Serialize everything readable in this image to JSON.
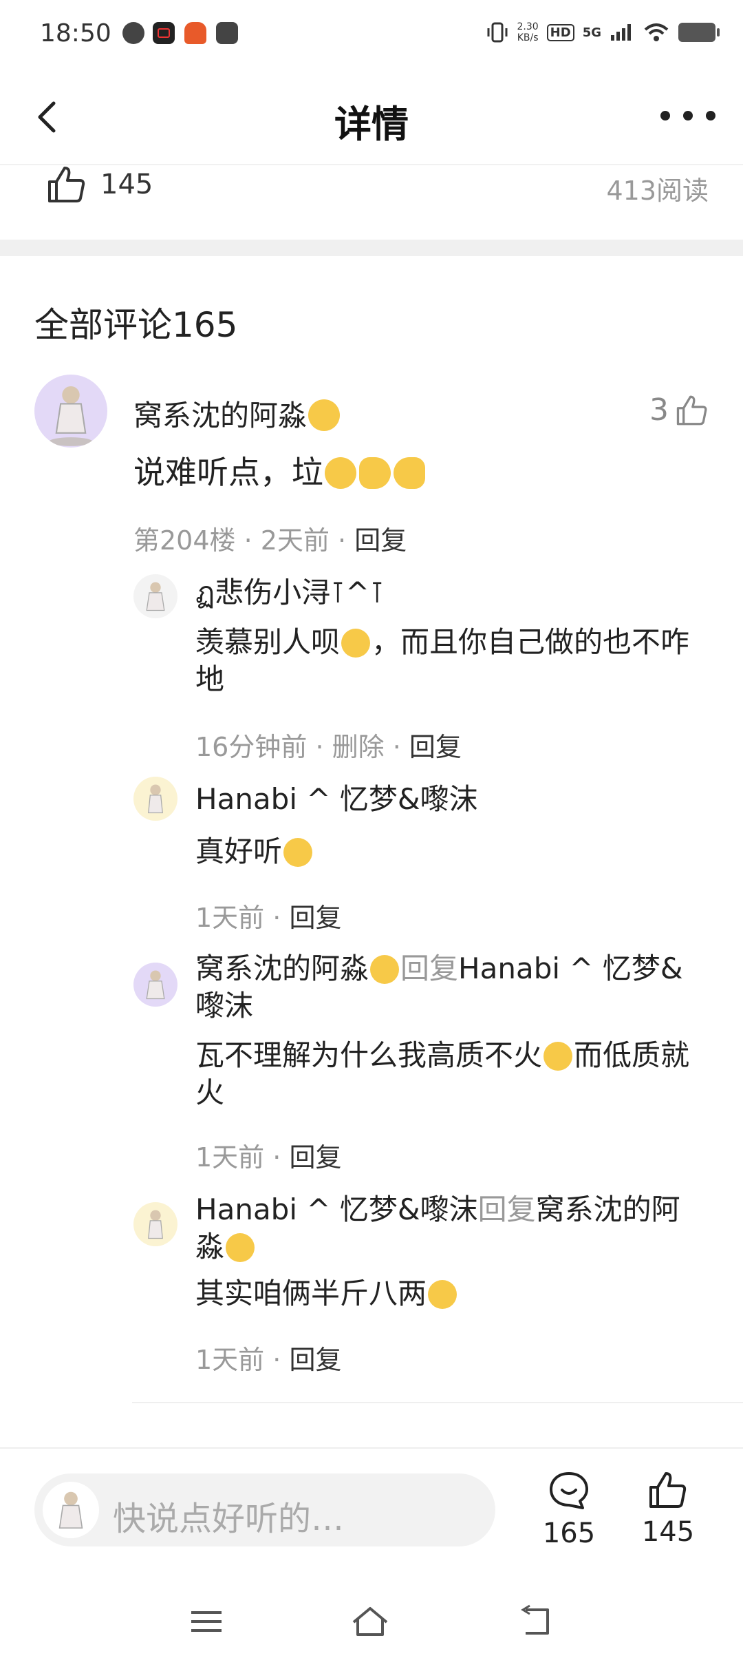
{
  "status_bar": {
    "time": "18:50",
    "speed_value": "2.30",
    "speed_unit": "KB/s",
    "hd": "HD",
    "network": "5G"
  },
  "nav": {
    "title": "详情"
  },
  "post_stats": {
    "likes": "145",
    "reads": "413阅读"
  },
  "comments_header": "全部评论165",
  "main_comment": {
    "author": "窝系沈的阿淼",
    "text": "说难听点，垃",
    "likes": "3",
    "floor": "第204楼",
    "time": "2天前",
    "reply_label": "回复"
  },
  "replies": [
    {
      "author": "ฏ悲伤小浔⊺^⊺",
      "text": "羡慕别人呗",
      "text_after_emoji": "，而且你自己做的也不咋地",
      "time": "16分钟前",
      "delete_label": "删除",
      "reply_label": "回复"
    },
    {
      "author": "Hanabi ^ 忆梦&嚟沫",
      "text": "真好听",
      "time": "1天前",
      "reply_label": "回复"
    },
    {
      "author": "窝系沈的阿淼",
      "reply_word": "回复",
      "target": "Hanabi ^ 忆梦&嚟沫",
      "text": "瓦不理解为什么我高质不火",
      "text_after_emoji": "而低质就火",
      "time": "1天前",
      "reply_label": "回复"
    },
    {
      "author": "Hanabi ^ 忆梦&嚟沫",
      "reply_word": "回复",
      "target": "窝系沈的阿淼",
      "text": "其实咱俩半斤八两",
      "time": "1天前",
      "reply_label": "回复"
    }
  ],
  "composer": {
    "placeholder": "快说点好听的…",
    "comment_count": "165",
    "like_count": "145"
  },
  "colors": {
    "text_primary": "#222222",
    "text_secondary": "#999999",
    "avatar_bg_purple": "#e3d9f7",
    "avatar_bg_yellow": "#fbf3d2",
    "emoji_yellow": "#f7c948"
  }
}
